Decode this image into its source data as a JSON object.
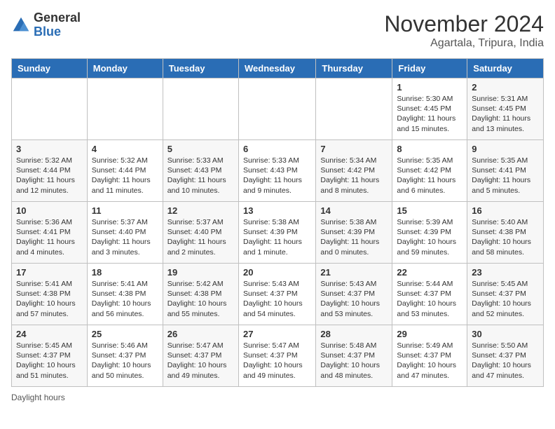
{
  "header": {
    "logo_general": "General",
    "logo_blue": "Blue",
    "month_title": "November 2024",
    "location": "Agartala, Tripura, India"
  },
  "days_of_week": [
    "Sunday",
    "Monday",
    "Tuesday",
    "Wednesday",
    "Thursday",
    "Friday",
    "Saturday"
  ],
  "weeks": [
    [
      {
        "day": "",
        "info": ""
      },
      {
        "day": "",
        "info": ""
      },
      {
        "day": "",
        "info": ""
      },
      {
        "day": "",
        "info": ""
      },
      {
        "day": "",
        "info": ""
      },
      {
        "day": "1",
        "info": "Sunrise: 5:30 AM\nSunset: 4:45 PM\nDaylight: 11 hours and 15 minutes."
      },
      {
        "day": "2",
        "info": "Sunrise: 5:31 AM\nSunset: 4:45 PM\nDaylight: 11 hours and 13 minutes."
      }
    ],
    [
      {
        "day": "3",
        "info": "Sunrise: 5:32 AM\nSunset: 4:44 PM\nDaylight: 11 hours and 12 minutes."
      },
      {
        "day": "4",
        "info": "Sunrise: 5:32 AM\nSunset: 4:44 PM\nDaylight: 11 hours and 11 minutes."
      },
      {
        "day": "5",
        "info": "Sunrise: 5:33 AM\nSunset: 4:43 PM\nDaylight: 11 hours and 10 minutes."
      },
      {
        "day": "6",
        "info": "Sunrise: 5:33 AM\nSunset: 4:43 PM\nDaylight: 11 hours and 9 minutes."
      },
      {
        "day": "7",
        "info": "Sunrise: 5:34 AM\nSunset: 4:42 PM\nDaylight: 11 hours and 8 minutes."
      },
      {
        "day": "8",
        "info": "Sunrise: 5:35 AM\nSunset: 4:42 PM\nDaylight: 11 hours and 6 minutes."
      },
      {
        "day": "9",
        "info": "Sunrise: 5:35 AM\nSunset: 4:41 PM\nDaylight: 11 hours and 5 minutes."
      }
    ],
    [
      {
        "day": "10",
        "info": "Sunrise: 5:36 AM\nSunset: 4:41 PM\nDaylight: 11 hours and 4 minutes."
      },
      {
        "day": "11",
        "info": "Sunrise: 5:37 AM\nSunset: 4:40 PM\nDaylight: 11 hours and 3 minutes."
      },
      {
        "day": "12",
        "info": "Sunrise: 5:37 AM\nSunset: 4:40 PM\nDaylight: 11 hours and 2 minutes."
      },
      {
        "day": "13",
        "info": "Sunrise: 5:38 AM\nSunset: 4:39 PM\nDaylight: 11 hours and 1 minute."
      },
      {
        "day": "14",
        "info": "Sunrise: 5:38 AM\nSunset: 4:39 PM\nDaylight: 11 hours and 0 minutes."
      },
      {
        "day": "15",
        "info": "Sunrise: 5:39 AM\nSunset: 4:39 PM\nDaylight: 10 hours and 59 minutes."
      },
      {
        "day": "16",
        "info": "Sunrise: 5:40 AM\nSunset: 4:38 PM\nDaylight: 10 hours and 58 minutes."
      }
    ],
    [
      {
        "day": "17",
        "info": "Sunrise: 5:41 AM\nSunset: 4:38 PM\nDaylight: 10 hours and 57 minutes."
      },
      {
        "day": "18",
        "info": "Sunrise: 5:41 AM\nSunset: 4:38 PM\nDaylight: 10 hours and 56 minutes."
      },
      {
        "day": "19",
        "info": "Sunrise: 5:42 AM\nSunset: 4:38 PM\nDaylight: 10 hours and 55 minutes."
      },
      {
        "day": "20",
        "info": "Sunrise: 5:43 AM\nSunset: 4:37 PM\nDaylight: 10 hours and 54 minutes."
      },
      {
        "day": "21",
        "info": "Sunrise: 5:43 AM\nSunset: 4:37 PM\nDaylight: 10 hours and 53 minutes."
      },
      {
        "day": "22",
        "info": "Sunrise: 5:44 AM\nSunset: 4:37 PM\nDaylight: 10 hours and 53 minutes."
      },
      {
        "day": "23",
        "info": "Sunrise: 5:45 AM\nSunset: 4:37 PM\nDaylight: 10 hours and 52 minutes."
      }
    ],
    [
      {
        "day": "24",
        "info": "Sunrise: 5:45 AM\nSunset: 4:37 PM\nDaylight: 10 hours and 51 minutes."
      },
      {
        "day": "25",
        "info": "Sunrise: 5:46 AM\nSunset: 4:37 PM\nDaylight: 10 hours and 50 minutes."
      },
      {
        "day": "26",
        "info": "Sunrise: 5:47 AM\nSunset: 4:37 PM\nDaylight: 10 hours and 49 minutes."
      },
      {
        "day": "27",
        "info": "Sunrise: 5:47 AM\nSunset: 4:37 PM\nDaylight: 10 hours and 49 minutes."
      },
      {
        "day": "28",
        "info": "Sunrise: 5:48 AM\nSunset: 4:37 PM\nDaylight: 10 hours and 48 minutes."
      },
      {
        "day": "29",
        "info": "Sunrise: 5:49 AM\nSunset: 4:37 PM\nDaylight: 10 hours and 47 minutes."
      },
      {
        "day": "30",
        "info": "Sunrise: 5:50 AM\nSunset: 4:37 PM\nDaylight: 10 hours and 47 minutes."
      }
    ]
  ],
  "footer": {
    "note": "Daylight hours"
  }
}
